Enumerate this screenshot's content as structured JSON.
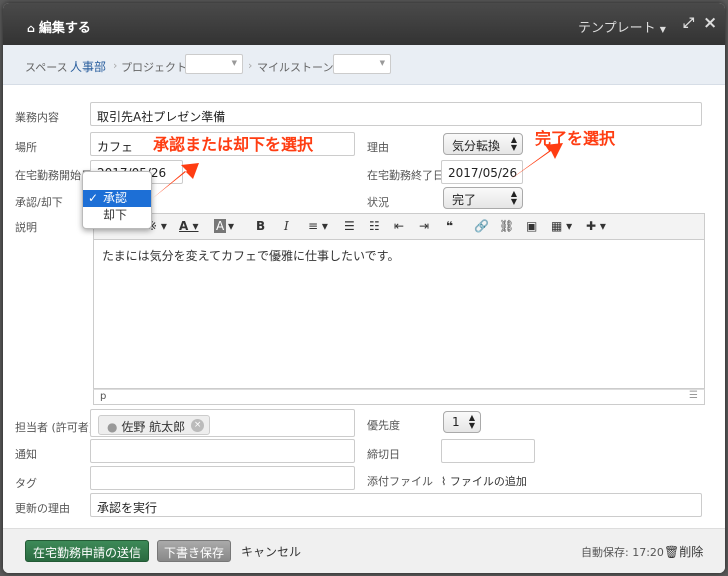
{
  "title": "編集する",
  "template_label": "テンプレート",
  "breadcrumb": {
    "space_label": "スペース",
    "space_value": "人事部",
    "project_label": "プロジェクト",
    "milestone_label": "マイルストーン"
  },
  "fields": {
    "task_label": "業務内容",
    "task_value": "取引先A社プレゼン準備",
    "place_label": "場所",
    "place_value": "カフェ",
    "reason_label": "理由",
    "reason_value": "気分転換",
    "start_label": "在宅勤務開始日",
    "start_value": "2017/05/26",
    "end_label": "在宅勤務終了日",
    "end_value": "2017/05/26",
    "approval_label": "承認/却下",
    "status_label": "状況",
    "status_value": "完了",
    "desc_label": "説明",
    "desc_value": "たまには気分を変えてカフェで優雅に仕事したいです。",
    "desc_path": "p",
    "assignee_label": "担当者 (許可者)",
    "assignee_value": "佐野 航太郎",
    "priority_label": "優先度",
    "priority_value": "1",
    "notify_label": "通知",
    "due_label": "締切日",
    "tag_label": "タグ",
    "attach_label": "添付ファイル",
    "attach_link": "ファイルの追加",
    "update_reason_label": "更新の理由",
    "update_reason_value": "承認を実行"
  },
  "toolbar": {
    "heading_partial": "※",
    "bold": "B",
    "italic": "I"
  },
  "dropdown": {
    "options": [
      "承認",
      "却下"
    ],
    "selected": "承認"
  },
  "footer": {
    "submit": "在宅勤務申請の送信",
    "draft": "下書き保存",
    "cancel": "キャンセル",
    "autosave": "自動保存: 17:20",
    "delete": "削除"
  },
  "annotations": {
    "left": "承認または却下を選択",
    "right": "完了を選択"
  },
  "colors": {
    "annotation": "#ff3d12",
    "primary_button": "#2f7a4a",
    "dropdown_selected": "#1d6fd6"
  }
}
